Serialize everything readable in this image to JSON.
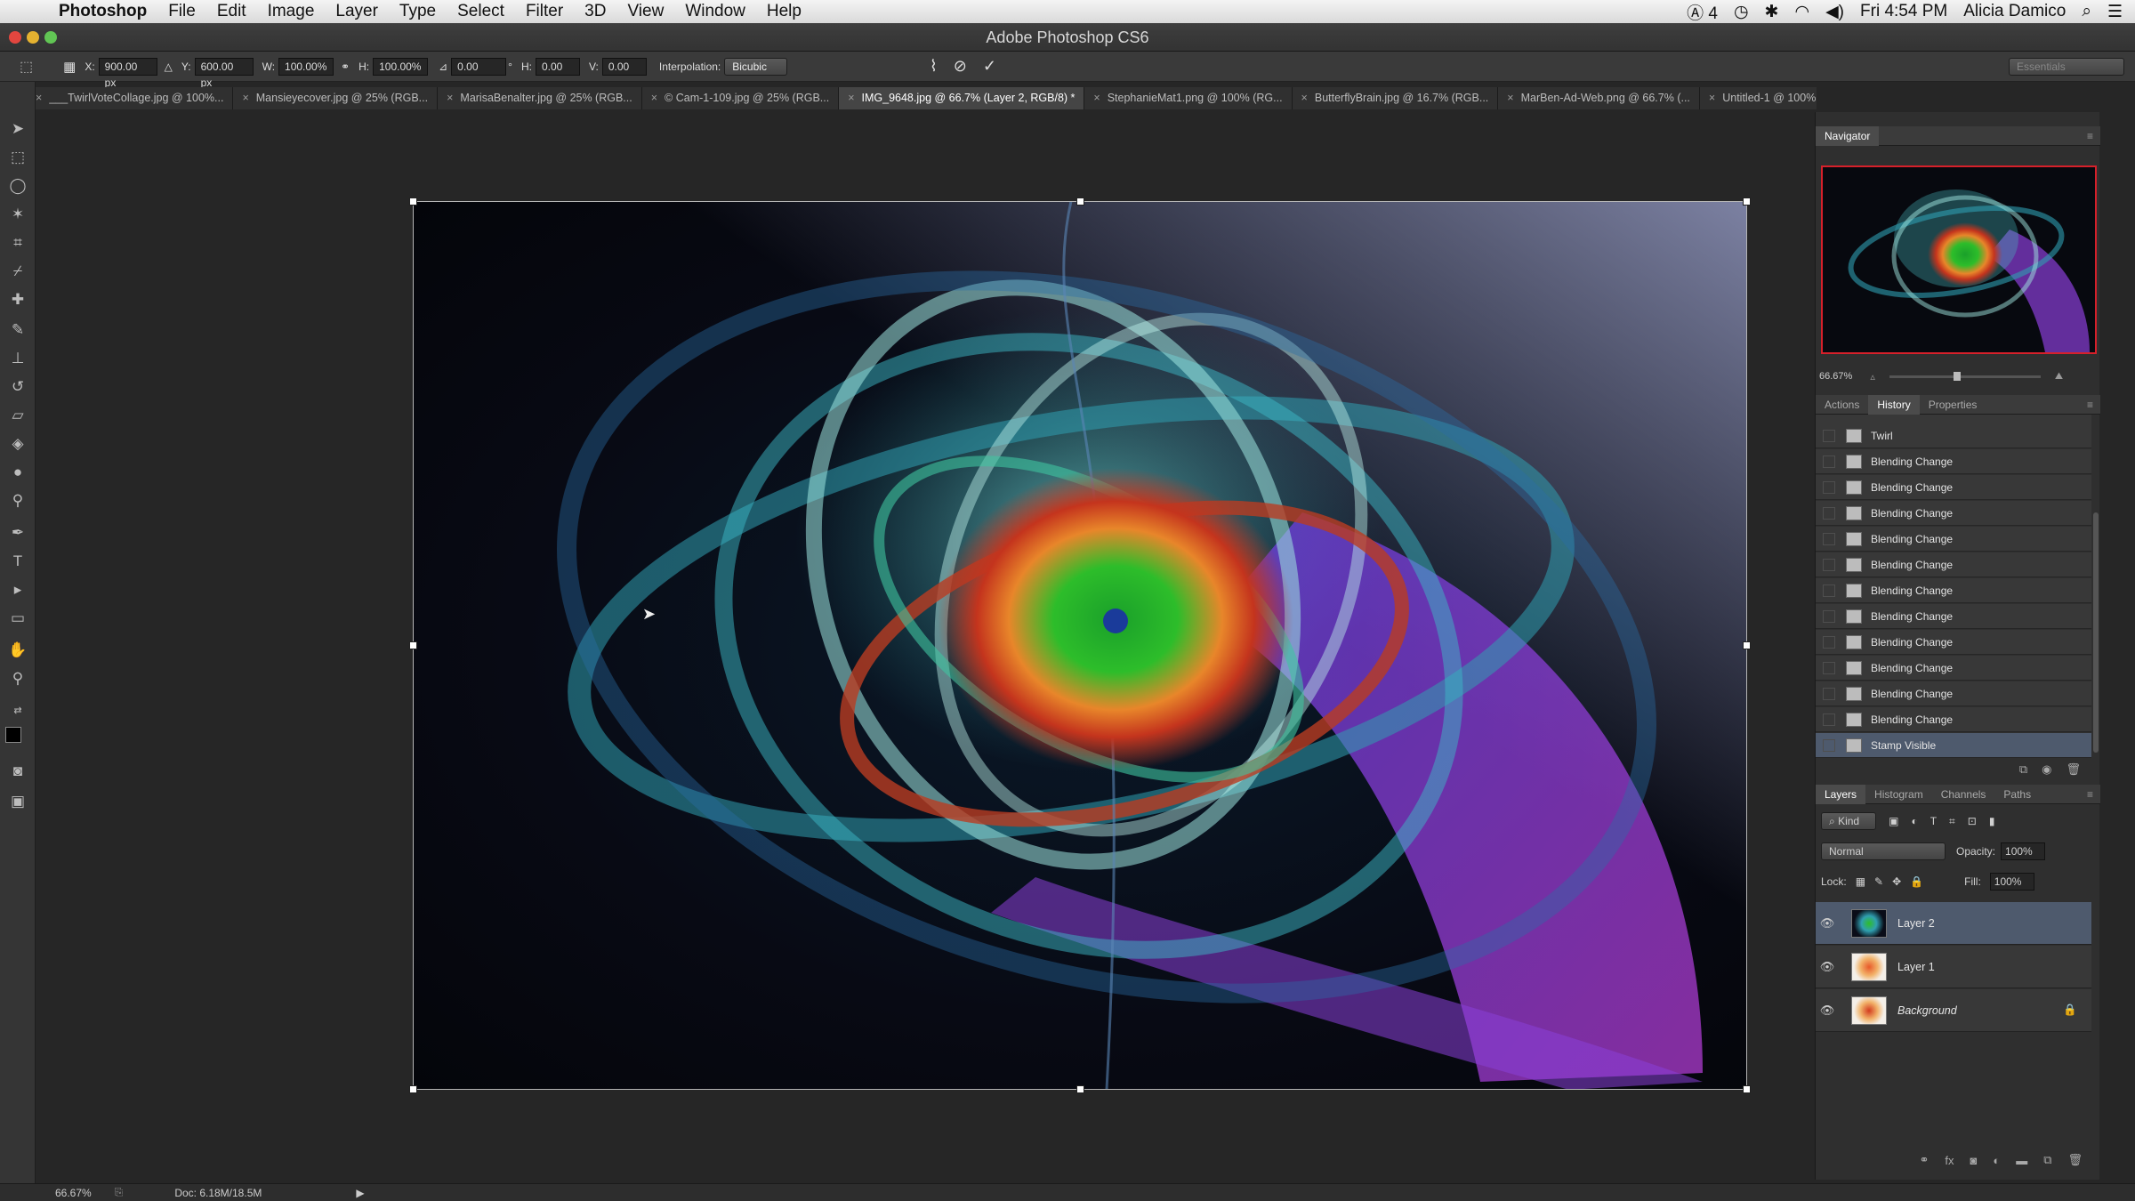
{
  "menubar": {
    "app_name": "Photoshop",
    "items": [
      "File",
      "Edit",
      "Image",
      "Layer",
      "Type",
      "Select",
      "Filter",
      "3D",
      "View",
      "Window",
      "Help"
    ],
    "adobe_count": "4",
    "clock": "Fri 4:54 PM",
    "user": "Alicia Damico"
  },
  "window": {
    "title": "Adobe Photoshop CS6"
  },
  "options": {
    "x_label": "X:",
    "x_value": "900.00 px",
    "y_label": "Y:",
    "y_value": "600.00 px",
    "w_label": "W:",
    "w_value": "100.00%",
    "h_label": "H:",
    "h_value": "100.00%",
    "angle_value": "0.00",
    "hskew_label": "H:",
    "hskew_value": "0.00",
    "vskew_label": "V:",
    "vskew_value": "0.00",
    "interp_label": "Interpolation:",
    "interp_value": "Bicubic",
    "workspace": "Essentials"
  },
  "tabs": [
    "___TwirlVoteCollage.jpg @ 100%...",
    "Mansieyecover.jpg @ 25% (RGB...",
    "MarisaBenalter.jpg @ 25% (RGB...",
    "© Cam-1-109.jpg @ 25% (RGB...",
    "IMG_9648.jpg @ 66.7% (Layer 2, RGB/8) *",
    "StephanieMat1.png @ 100% (RG...",
    "ButterflyBrain.jpg @ 16.7% (RGB...",
    "MarBen-Ad-Web.png @ 66.7% (...",
    "Untitled-1 @ 100% (Pure Emotio..."
  ],
  "navigator": {
    "title": "Navigator",
    "zoom": "66.67%"
  },
  "history_panel": {
    "tabs": [
      "Actions",
      "History",
      "Properties"
    ],
    "items": [
      "Twirl",
      "Blending Change",
      "Blending Change",
      "Blending Change",
      "Blending Change",
      "Blending Change",
      "Blending Change",
      "Blending Change",
      "Blending Change",
      "Blending Change",
      "Blending Change",
      "Blending Change",
      "Stamp Visible"
    ]
  },
  "layers_panel": {
    "tabs": [
      "Layers",
      "Histogram",
      "Channels",
      "Paths"
    ],
    "kind": "Kind",
    "blend_mode": "Normal",
    "opacity_label": "Opacity:",
    "opacity": "100%",
    "lock_label": "Lock:",
    "fill_label": "Fill:",
    "fill": "100%",
    "layers": [
      "Layer 2",
      "Layer 1",
      "Background"
    ]
  },
  "status": {
    "zoom": "66.67%",
    "doc": "Doc: 6.18M/18.5M"
  }
}
